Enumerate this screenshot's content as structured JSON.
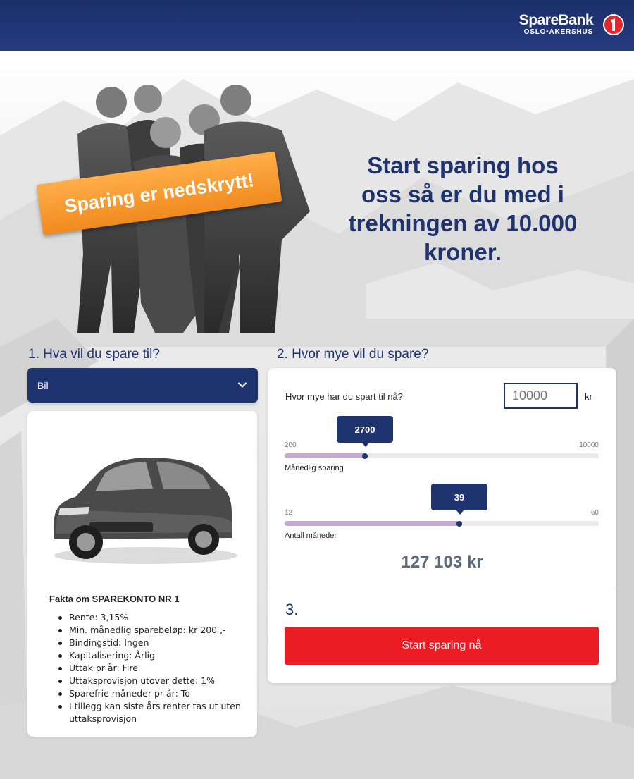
{
  "brand": {
    "name": "SpareBank",
    "sub": "OSLO•AKERSHUS",
    "mark": "1",
    "color": "#1f336f",
    "cta_color": "#ec1c24"
  },
  "hero": {
    "sign_text": "Sparing er nedskrytt!",
    "headline": "Start sparing hos oss så er du med i trekningen av 10.000 kroner."
  },
  "step1": {
    "title": "1. Hva vil du spare til?",
    "selected": "Bil",
    "facts_title": "Fakta om SPAREKONTO NR 1",
    "facts": [
      "Rente: 3,15%",
      "Min. månedlig sparebeløp: kr 200 ,-",
      "Bindingstid: Ingen",
      "Kapitalisering: Årlig",
      "Uttak pr år: Fire",
      "Uttaksprovisjon utover dette: 1%",
      "Sparefrie måneder pr år: To",
      "I tillegg kan siste års renter tas ut uten uttaksprovisjon"
    ]
  },
  "step2": {
    "title": "2. Hvor mye vil du spare?",
    "saved_label": "Hvor mye har du spart til nå?",
    "saved_value": "10000",
    "unit": "kr",
    "monthly": {
      "value": "2700",
      "min": "200",
      "max": "10000",
      "label": "Månedlig sparing",
      "fraction": 0.255
    },
    "months": {
      "value": "39",
      "min": "12",
      "max": "60",
      "label": "Antall måneder",
      "fraction": 0.555
    },
    "result": "127 103 kr"
  },
  "step3": {
    "title": "3.",
    "button": "Start sparing nå"
  }
}
